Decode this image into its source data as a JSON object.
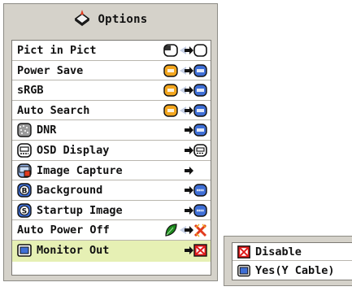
{
  "header": {
    "title": "Options",
    "icon": "options-icon"
  },
  "menu": [
    {
      "label": "Pict in Pict"
    },
    {
      "label": "Power Save"
    },
    {
      "label": "sRGB"
    },
    {
      "label": "Auto Search"
    },
    {
      "label": "DNR"
    },
    {
      "label": "OSD Display"
    },
    {
      "label": "Image Capture"
    },
    {
      "label": "Background"
    },
    {
      "label": "Startup Image"
    },
    {
      "label": "Auto Power Off"
    },
    {
      "label": "Monitor Out"
    }
  ],
  "submenu": {
    "items": [
      {
        "label": "Disable"
      },
      {
        "label": "Yes(Y Cable)"
      }
    ]
  },
  "colors": {
    "panel": "#d5d2ca",
    "selected_row": "#e6f0b4",
    "toggle_on": "#f2a61e",
    "toggle_off": "#3f6fd6",
    "arrow_inactive": "#c3cde3",
    "disable_red": "#e01b1b",
    "leaf_green": "#1e8a1e"
  }
}
